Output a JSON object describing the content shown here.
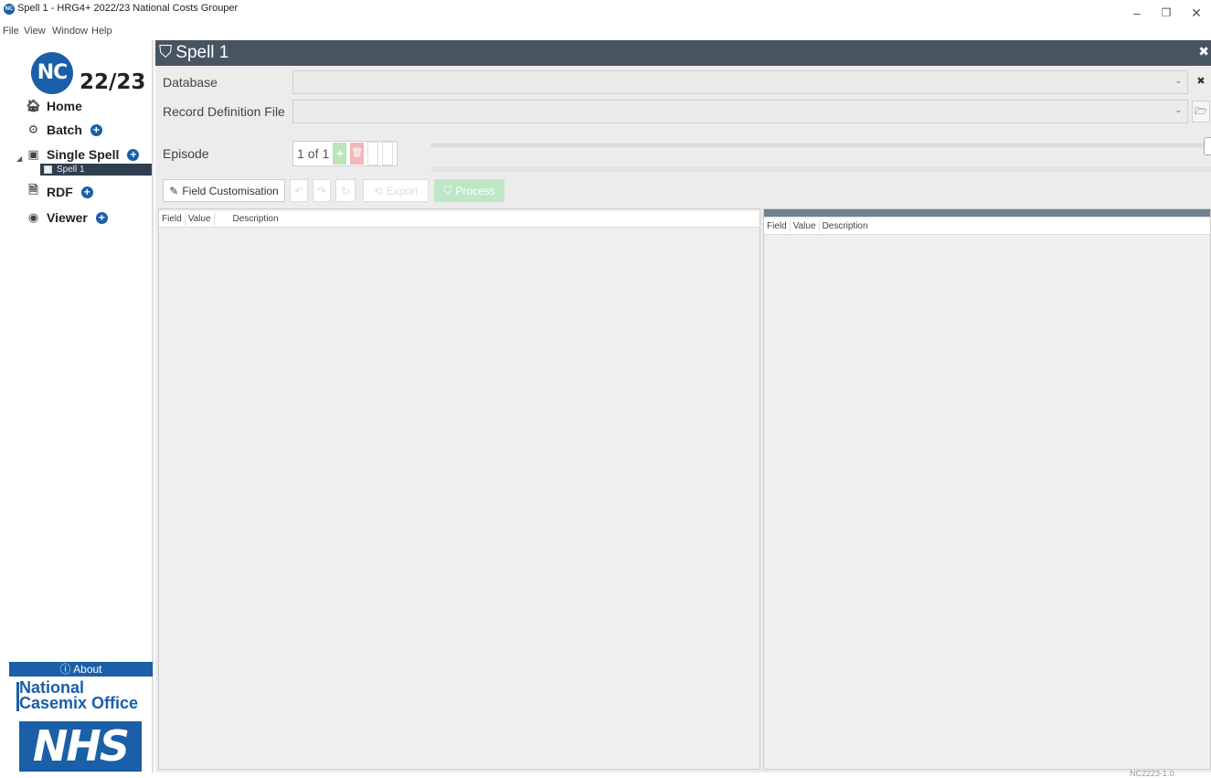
{
  "window": {
    "title": "Spell 1 - HRG4+ 2022/23 National Costs Grouper",
    "app_icon_text": "NC",
    "minimize": "–",
    "restore": "❐",
    "close": "✕"
  },
  "menu": [
    "File",
    "View",
    "Window",
    "Help"
  ],
  "sidebar": {
    "logo_nc": "NC",
    "logo_year": "22/23",
    "items": [
      {
        "label": "Home",
        "icon": "home-icon"
      },
      {
        "label": "Batch",
        "icon": "batch-icon"
      },
      {
        "label": "Single Spell",
        "icon": "box-icon"
      },
      {
        "label": "RDF",
        "icon": "document-icon"
      },
      {
        "label": "Viewer",
        "icon": "eye-icon"
      }
    ],
    "spell_child": "Spell 1",
    "about": "About",
    "nco_line1": "National",
    "nco_line2": "Casemix Office",
    "nhs": "NHS"
  },
  "document": {
    "title": "Spell 1",
    "close": "✖"
  },
  "form": {
    "database_label": "Database",
    "database_value": "",
    "rdf_label": "Record Definition File",
    "rdf_value": ""
  },
  "episode": {
    "label": "Episode",
    "current": "1",
    "of_text": "of",
    "total": "1"
  },
  "toolbar": {
    "field_customisation": "Field Customisation",
    "export": "Export",
    "process": "Process"
  },
  "left_table": {
    "columns": [
      "Field",
      "Value",
      "Description"
    ]
  },
  "right_table": {
    "columns": [
      "Field",
      "Value",
      "Description"
    ]
  },
  "footer": {
    "version": "NC2223-1.0"
  },
  "colors": {
    "accent": "#1a5fa8",
    "header": "#475561",
    "process": "#bfe7c6"
  }
}
